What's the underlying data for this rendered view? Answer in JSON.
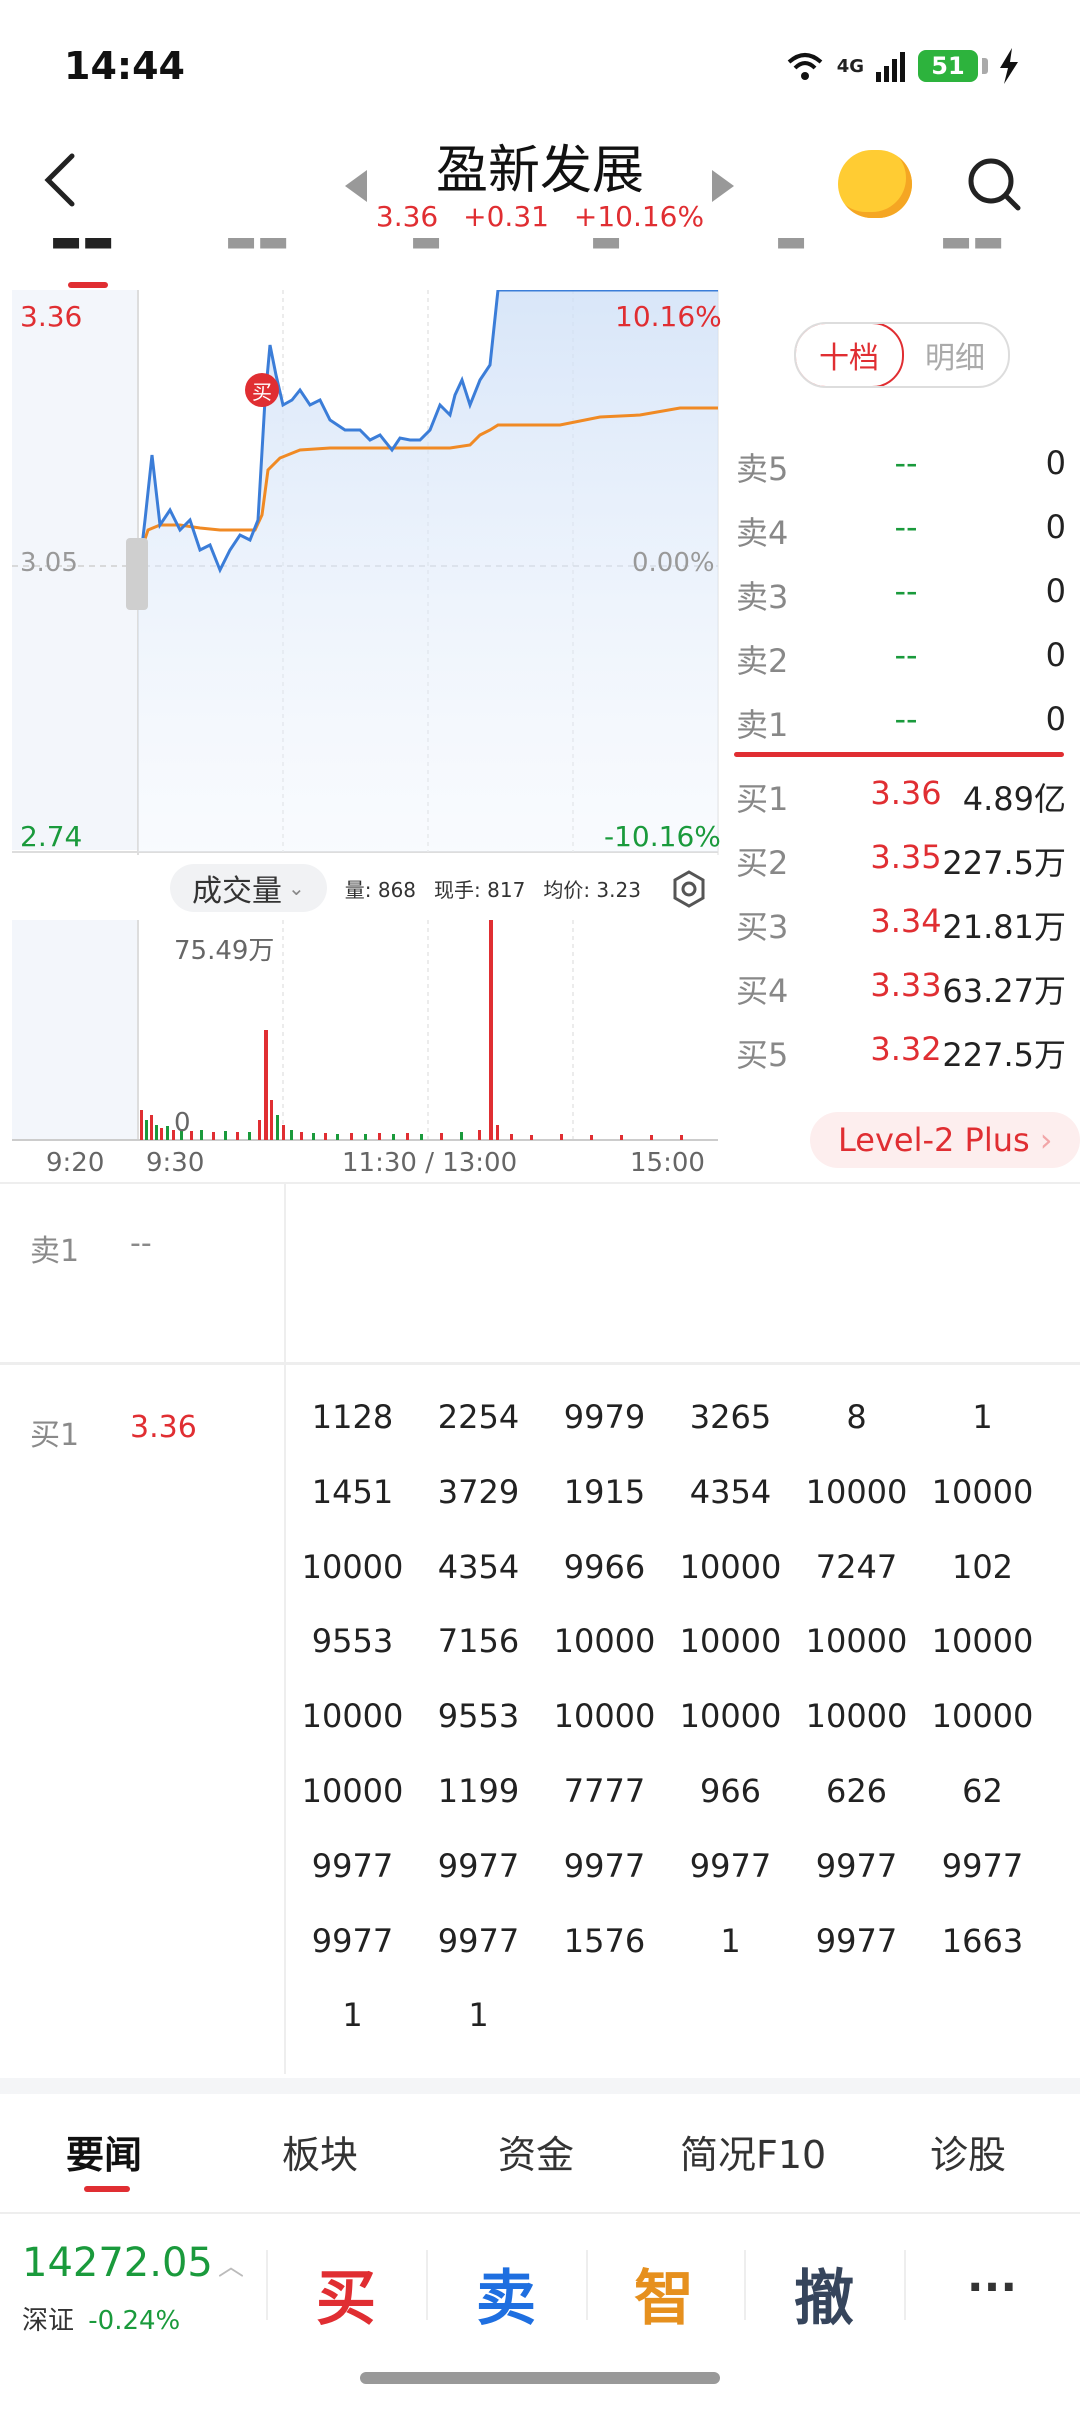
{
  "status_bar": {
    "time": "14:44",
    "network": "4G",
    "battery": "51"
  },
  "header": {
    "title": "盈新发展",
    "price": "3.36",
    "change": "+0.31",
    "change_pct": "+10.16%"
  },
  "chart": {
    "price_high": "3.36",
    "price_base": "3.05",
    "price_low": "2.74",
    "pct_high": "10.16%",
    "pct_base": "0.00%",
    "pct_low": "-10.16%",
    "volume_selector": "成交量",
    "volume_info": {
      "vol": "量: 868",
      "hand": "现手: 817",
      "avg": "均价: 3.23"
    },
    "volume_max": "75.49万",
    "volume_zero": "0",
    "time_labels": [
      "9:20",
      "9:30",
      "11:30 / 13:00",
      "15:00"
    ],
    "buy_marker": "买",
    "colors": {
      "price_line": "#3b7dd8",
      "avg_line": "#f08a24",
      "up": "#e02e32",
      "down": "#1a9a3c"
    }
  },
  "order_book": {
    "tabs": [
      "十档",
      "明细"
    ],
    "sell": [
      {
        "label": "卖5",
        "price": "--",
        "vol": "0"
      },
      {
        "label": "卖4",
        "price": "--",
        "vol": "0"
      },
      {
        "label": "卖3",
        "price": "--",
        "vol": "0"
      },
      {
        "label": "卖2",
        "price": "--",
        "vol": "0"
      },
      {
        "label": "卖1",
        "price": "--",
        "vol": "0"
      }
    ],
    "buy": [
      {
        "label": "买1",
        "price": "3.36",
        "vol": "4.89亿"
      },
      {
        "label": "买2",
        "price": "3.35",
        "vol": "227.5万"
      },
      {
        "label": "买3",
        "price": "3.34",
        "vol": "21.81万"
      },
      {
        "label": "买4",
        "price": "3.33",
        "vol": "63.27万"
      },
      {
        "label": "买5",
        "price": "3.32",
        "vol": "227.5万"
      }
    ],
    "level2": "Level-2 Plus"
  },
  "queue": {
    "sell1_label": "卖1",
    "sell1_price": "--",
    "buy1_label": "买1",
    "buy1_price": "3.36",
    "cells": [
      "1128",
      "2254",
      "9979",
      "3265",
      "8",
      "1",
      "1451",
      "3729",
      "1915",
      "4354",
      "10000",
      "10000",
      "10000",
      "4354",
      "9966",
      "10000",
      "7247",
      "102",
      "9553",
      "7156",
      "10000",
      "10000",
      "10000",
      "10000",
      "10000",
      "9553",
      "10000",
      "10000",
      "10000",
      "10000",
      "10000",
      "1199",
      "7777",
      "966",
      "626",
      "62",
      "9977",
      "9977",
      "9977",
      "9977",
      "9977",
      "9977",
      "9977",
      "9977",
      "1576",
      "1",
      "9977",
      "1663",
      "1",
      "1"
    ]
  },
  "news_tabs": [
    "要闻",
    "板块",
    "资金",
    "简况F10",
    "诊股"
  ],
  "index": {
    "value": "14272.05",
    "name": "深证",
    "change": "-0.24%"
  },
  "actions": {
    "buy": "买",
    "sell": "卖",
    "smart": "智",
    "cancel": "撤",
    "more": "···"
  }
}
